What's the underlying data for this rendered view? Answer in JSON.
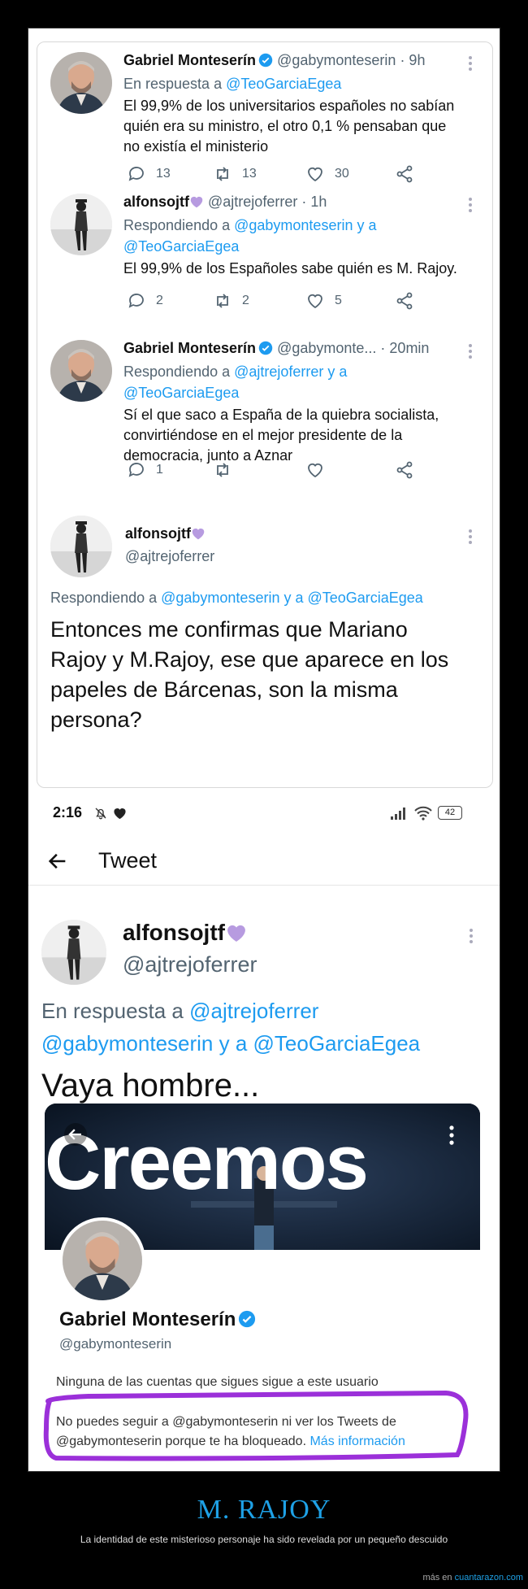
{
  "tweets": [
    {
      "name": "Gabriel Monteserín",
      "handle": "@gabymonteserin",
      "time": "· 9h",
      "reply_prefix": "En respuesta a ",
      "reply_targets": "@TeoGarciaEgea",
      "reply_suffix": "",
      "lines": [
        "El 99,9% de los universitarios españoles no sabían",
        "quién era su ministro, el otro 0,1 % pensaban que",
        "no existía el ministerio"
      ],
      "replies": "13",
      "retweets": "13",
      "likes": "30"
    },
    {
      "name": "alfonsojtf",
      "handle": "@ajtrejoferrer",
      "time": "· 1h",
      "reply_prefix": "Respondiendo a ",
      "reply_targets": "@gabymonteserin y a",
      "reply_line2": "@TeoGarciaEgea",
      "lines": [
        "El 99,9% de los Españoles sabe quién es M. Rajoy."
      ],
      "replies": "2",
      "retweets": "2",
      "likes": "5"
    },
    {
      "name": "Gabriel Monteserín",
      "handle": "@gabymonte...",
      "time": "· 20min",
      "reply_prefix": "Respondiendo a ",
      "reply_targets": "@ajtrejoferrer y a",
      "reply_line2": "@TeoGarciaEgea",
      "lines": [
        "Sí el que saco a España de la quiebra socialista,",
        "convirtiéndose en el mejor presidente de la",
        "democracia, junto a Aznar"
      ],
      "replies": "1",
      "retweets": "",
      "likes": ""
    },
    {
      "name": "alfonsojtf",
      "handle": "@ajtrejoferrer",
      "reply_prefix": "Respondiendo a ",
      "reply_targets": "@gabymonteserin y a @TeoGarciaEgea",
      "lines": [
        "Entonces me confirmas que Mariano",
        "Rajoy y M.Rajoy, ese que aparece en los",
        "papeles de Bárcenas, son la misma",
        "persona?"
      ]
    }
  ],
  "status_bar": {
    "time": "2:16",
    "battery": "42"
  },
  "header": {
    "title": "Tweet"
  },
  "main_tweet": {
    "name": "alfonsojtf",
    "handle": "@ajtrejoferrer",
    "reply_prefix": "En respuesta a ",
    "reply_line1": "@ajtrejoferrer",
    "reply_line2": "@gabymonteserin y a @TeoGarciaEgea",
    "text": "Vaya hombre..."
  },
  "profile": {
    "banner_text": "Creemos",
    "name": "Gabriel Monteserín",
    "handle": "@gabymonteserin",
    "no_follow": "Ninguna de las cuentas que sigues sigue a este usuario",
    "blocked_line1": "No puedes seguir a @gabymonteserin ni ver los Tweets de",
    "blocked_line2": "@gabymonteserin porque te ha bloqueado. ",
    "more_info": "Más información"
  },
  "footer": {
    "title": "M. RAJOY",
    "subtitle": "La identidad de este misterioso personaje ha sido revelada por un pequeño descuido",
    "source_prefix": "más en ",
    "source_site": "cuantarazon.com"
  },
  "colors": {
    "link": "#1d9bf0",
    "verified": "#1d9bf0",
    "purple_heart": "#b79be0",
    "highlight": "#9b30d9",
    "footer_title": "#1ea1e6"
  }
}
